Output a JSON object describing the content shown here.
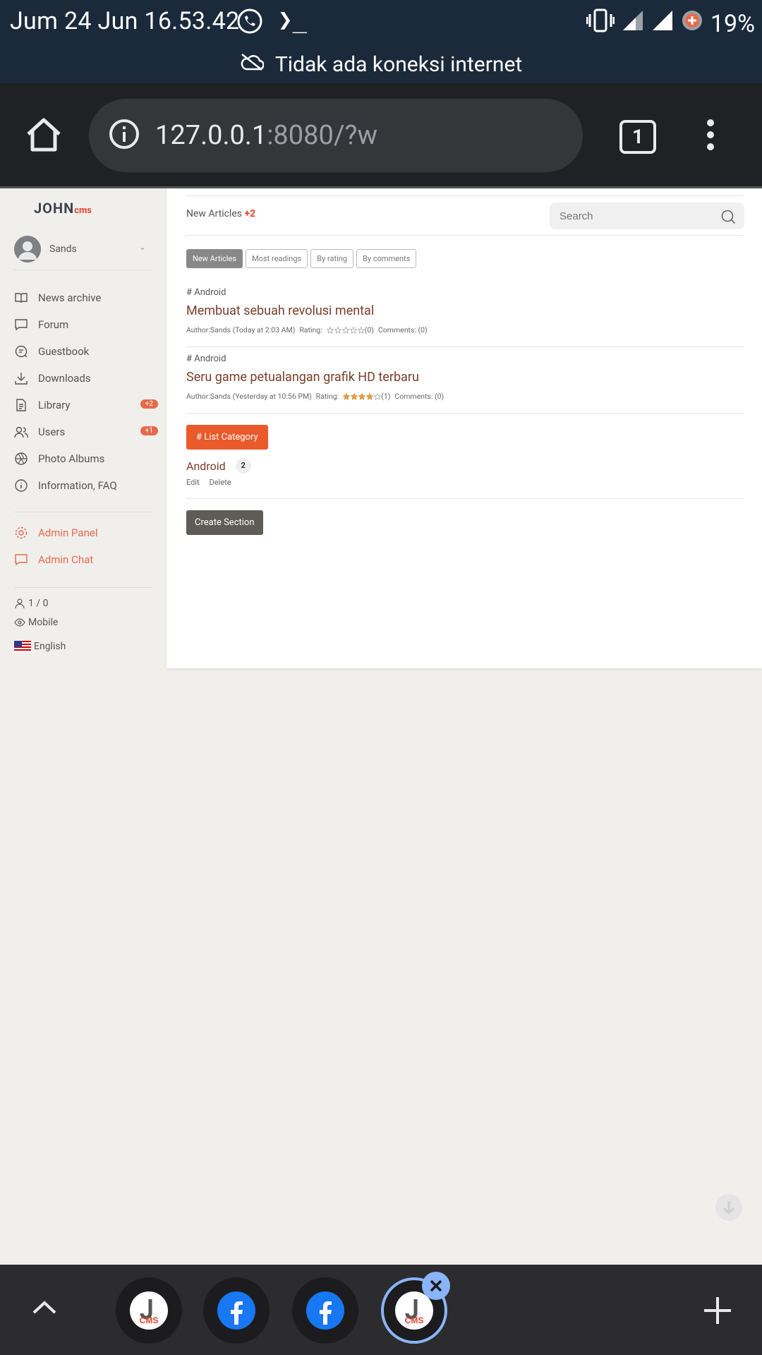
{
  "status_bar": {
    "time": "Jum 24 Jun 16.53.42",
    "battery": "19%",
    "offline_message": "Tidak ada koneksi internet"
  },
  "browser": {
    "url_host": "127.0.0.1",
    "url_rest": ":8080/?w",
    "tab_count": "1"
  },
  "sidebar": {
    "logo_john": "JOHN",
    "logo_cms": "cms",
    "user_name": "Sands",
    "items": [
      {
        "label": "News archive",
        "icon": "book-icon"
      },
      {
        "label": "Forum",
        "icon": "chat-icon"
      },
      {
        "label": "Guestbook",
        "icon": "guestbook-icon"
      },
      {
        "label": "Downloads",
        "icon": "download-icon"
      },
      {
        "label": "Library",
        "icon": "document-icon",
        "badge": "+2"
      },
      {
        "label": "Users",
        "icon": "users-icon",
        "badge": "+1"
      },
      {
        "label": "Photo Albums",
        "icon": "aperture-icon"
      },
      {
        "label": "Information, FAQ",
        "icon": "info-icon"
      }
    ],
    "admin_items": [
      {
        "label": "Admin Panel",
        "icon": "gear-icon"
      },
      {
        "label": "Admin Chat",
        "icon": "chat-icon"
      }
    ],
    "online_count": "1 / 0",
    "view_mode": "Mobile",
    "language": "English"
  },
  "main": {
    "new_articles_label": "New Articles",
    "new_articles_count": "+2",
    "search_placeholder": "Search",
    "tabs": [
      "New Articles",
      "Most readings",
      "By rating",
      "By comments"
    ],
    "articles": [
      {
        "category": "# Android",
        "title": "Membuat sebuah revolusi mental",
        "author": "Author:Sands (Today at 2:03 AM)",
        "rating_label": "Rating:",
        "rating_stars": 0,
        "rating_count": "(0)",
        "comments": "Comments: (0)"
      },
      {
        "category": "# Android",
        "title": "Seru game petualangan grafik HD terbaru",
        "author": "Author:Sands (Yesterday at 10:56 PM)",
        "rating_label": "Rating:",
        "rating_stars": 4,
        "rating_count": "(1)",
        "comments": "Comments: (0)"
      }
    ],
    "list_category_button": "# List Category",
    "category": {
      "name": "Android",
      "count": "2",
      "edit": "Edit",
      "delete": "Delete"
    },
    "create_section_button": "Create Section"
  },
  "colors": {
    "accent": "#ea5a2b",
    "link": "#7a3f2a",
    "statusbar": "#1b2a3b"
  }
}
